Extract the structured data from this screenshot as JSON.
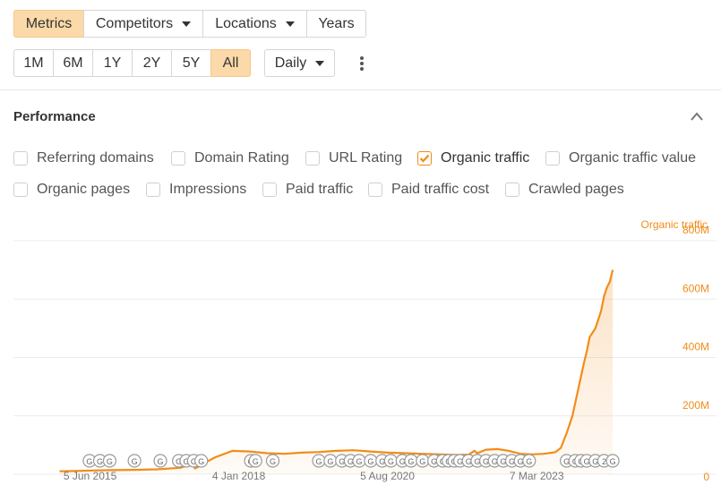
{
  "tabs": [
    {
      "label": "Metrics",
      "active": true,
      "caret": false
    },
    {
      "label": "Competitors",
      "active": false,
      "caret": true
    },
    {
      "label": "Locations",
      "active": false,
      "caret": true
    },
    {
      "label": "Years",
      "active": false,
      "caret": false
    }
  ],
  "ranges": [
    {
      "label": "1M",
      "active": false
    },
    {
      "label": "6M",
      "active": false
    },
    {
      "label": "1Y",
      "active": false
    },
    {
      "label": "2Y",
      "active": false
    },
    {
      "label": "5Y",
      "active": false
    },
    {
      "label": "All",
      "active": true
    }
  ],
  "interval": {
    "label": "Daily"
  },
  "section": {
    "title": "Performance"
  },
  "metrics_row1": [
    {
      "label": "Referring domains",
      "checked": false
    },
    {
      "label": "Domain Rating",
      "checked": false
    },
    {
      "label": "URL Rating",
      "checked": false
    },
    {
      "label": "Organic traffic",
      "checked": true
    },
    {
      "label": "Organic traffic value",
      "checked": false
    }
  ],
  "metrics_row2": [
    {
      "label": "Organic pages",
      "checked": false
    },
    {
      "label": "Impressions",
      "checked": false
    },
    {
      "label": "Paid traffic",
      "checked": false
    },
    {
      "label": "Paid traffic cost",
      "checked": false
    },
    {
      "label": "Crawled pages",
      "checked": false
    }
  ],
  "colors": {
    "accent": "#f28c1a",
    "active_bg": "#fcd9a8",
    "grid": "#ececec"
  },
  "icons": {
    "collapse": "chevron-up-icon",
    "more": "more-vertical-icon",
    "checkbox_check": "check-icon",
    "update_marker": "google-update-icon"
  },
  "chart_data": {
    "type": "area",
    "series": [
      {
        "name": "Organic traffic"
      }
    ],
    "legend_label": "Organic traffic",
    "y_ticks": [
      "0",
      "200M",
      "400M",
      "600M",
      "800M"
    ],
    "ylim": [
      0,
      800
    ],
    "y_unit": "M",
    "x_ticks": [
      "5 Jun 2015",
      "4 Jan 2018",
      "5 Aug 2020",
      "7 Mar 2023"
    ],
    "x_tick_values": [
      2015.43,
      2018.01,
      2020.59,
      2023.18
    ],
    "xlim": [
      2014.1,
      2025.4
    ],
    "x": [
      2014.9,
      2015.2,
      2015.5,
      2015.8,
      2016.2,
      2016.6,
      2017.0,
      2017.2,
      2017.25,
      2017.4,
      2017.45,
      2017.6,
      2017.9,
      2018.2,
      2018.5,
      2018.8,
      2019.1,
      2019.4,
      2019.7,
      2020.0,
      2020.3,
      2020.6,
      2020.9,
      2021.2,
      2021.5,
      2021.8,
      2022.0,
      2022.1,
      2022.15,
      2022.3,
      2022.5,
      2022.7,
      2022.9,
      2023.1,
      2023.3,
      2023.5,
      2023.6,
      2023.7,
      2023.8,
      2023.9,
      2024.0,
      2024.05,
      2024.1,
      2024.2,
      2024.3,
      2024.35,
      2024.4,
      2024.45,
      2024.5
    ],
    "y": [
      10,
      11,
      13,
      14,
      15,
      17,
      22,
      35,
      20,
      34,
      42,
      58,
      80,
      78,
      72,
      70,
      74,
      76,
      80,
      82,
      78,
      74,
      72,
      70,
      68,
      66,
      67,
      80,
      72,
      84,
      86,
      80,
      70,
      68,
      70,
      75,
      90,
      140,
      200,
      290,
      380,
      420,
      470,
      500,
      560,
      610,
      640,
      660,
      700
    ],
    "markers_label": "G",
    "marker_counts": [
      {
        "x": 2015.42,
        "label": "G"
      },
      {
        "x": 2015.6,
        "label": "G"
      },
      {
        "x": 2015.77,
        "label": "G"
      },
      {
        "x": 2016.2,
        "label": "G"
      },
      {
        "x": 2016.65,
        "label": "G"
      },
      {
        "x": 2016.97,
        "label": "G"
      },
      {
        "x": 2017.1,
        "label": "G"
      },
      {
        "x": 2017.23,
        "label": "G"
      },
      {
        "x": 2017.36,
        "label": "G"
      },
      {
        "x": 2018.22,
        "label": "G"
      },
      {
        "x": 2018.3,
        "label": "G"
      },
      {
        "x": 2018.6,
        "label": "G"
      },
      {
        "x": 2019.4,
        "label": "G"
      },
      {
        "x": 2019.6,
        "label": "G"
      },
      {
        "x": 2019.8,
        "label": "G"
      },
      {
        "x": 2019.95,
        "label": "G"
      },
      {
        "x": 2020.1,
        "label": "G"
      },
      {
        "x": 2020.3,
        "label": "G"
      },
      {
        "x": 2020.5,
        "label": "G"
      },
      {
        "x": 2020.65,
        "label": "G"
      },
      {
        "x": 2020.85,
        "label": "G"
      },
      {
        "x": 2021.0,
        "label": "G"
      },
      {
        "x": 2021.2,
        "label": "G"
      },
      {
        "x": 2021.4,
        "label": "G"
      },
      {
        "x": 2021.55,
        "label": "G"
      },
      {
        "x": 2021.65,
        "label": "G"
      },
      {
        "x": 2021.75,
        "label": "G"
      },
      {
        "x": 2021.85,
        "label": "G"
      },
      {
        "x": 2022.0,
        "label": "G"
      },
      {
        "x": 2022.15,
        "label": "G"
      },
      {
        "x": 2022.3,
        "label": "G"
      },
      {
        "x": 2022.45,
        "label": "G"
      },
      {
        "x": 2022.6,
        "label": "G"
      },
      {
        "x": 2022.75,
        "label": "G"
      },
      {
        "x": 2022.9,
        "label": "G"
      },
      {
        "x": 2023.05,
        "label": "G"
      },
      {
        "x": 2023.7,
        "label": "G"
      },
      {
        "x": 2023.85,
        "label": "G"
      },
      {
        "x": 2023.95,
        "label": "G"
      },
      {
        "x": 2024.05,
        "label": "G"
      },
      {
        "x": 2024.2,
        "label": "G"
      },
      {
        "x": 2024.35,
        "label": "2"
      },
      {
        "x": 2024.5,
        "label": "G"
      }
    ]
  }
}
